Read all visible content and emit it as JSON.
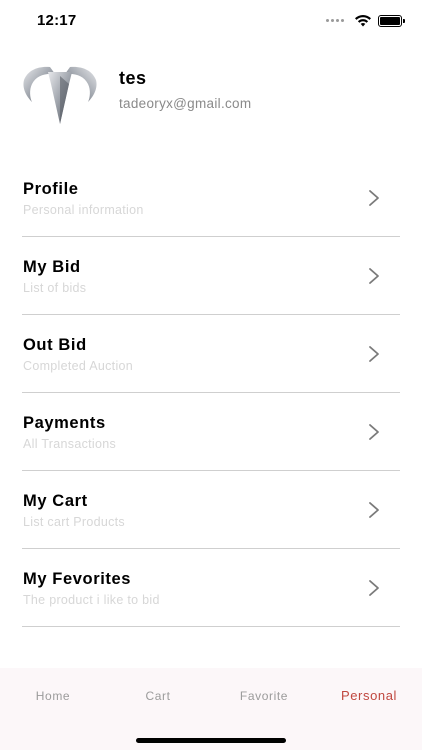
{
  "status_bar": {
    "time": "12:17"
  },
  "profile": {
    "name": "tes",
    "email": "tadeoryx@gmail.com"
  },
  "menu": {
    "items": [
      {
        "title": "Profile",
        "subtitle": "Personal information"
      },
      {
        "title": "My Bid",
        "subtitle": "List of bids"
      },
      {
        "title": "Out Bid",
        "subtitle": "Completed Auction"
      },
      {
        "title": "Payments",
        "subtitle": "All Transactions"
      },
      {
        "title": "My Cart",
        "subtitle": "List cart Products"
      },
      {
        "title": "My Fevorites",
        "subtitle": "The product i like to bid"
      }
    ]
  },
  "tab_bar": {
    "tabs": [
      {
        "label": "Home"
      },
      {
        "label": "Cart"
      },
      {
        "label": "Favorite"
      },
      {
        "label": "Personal"
      }
    ],
    "active_tab": "Personal"
  },
  "colors": {
    "accent": "#c0473f",
    "subtitle_text": "#d7d7d7",
    "divider": "#cfcfcf",
    "tab_bar_bg": "#fcf7f9"
  },
  "icons": {
    "logo": "horned-shield-logo",
    "chevron": "chevron-right-icon",
    "wifi": "wifi-icon",
    "battery": "battery-icon",
    "signal": "cellular-signal-icon"
  }
}
